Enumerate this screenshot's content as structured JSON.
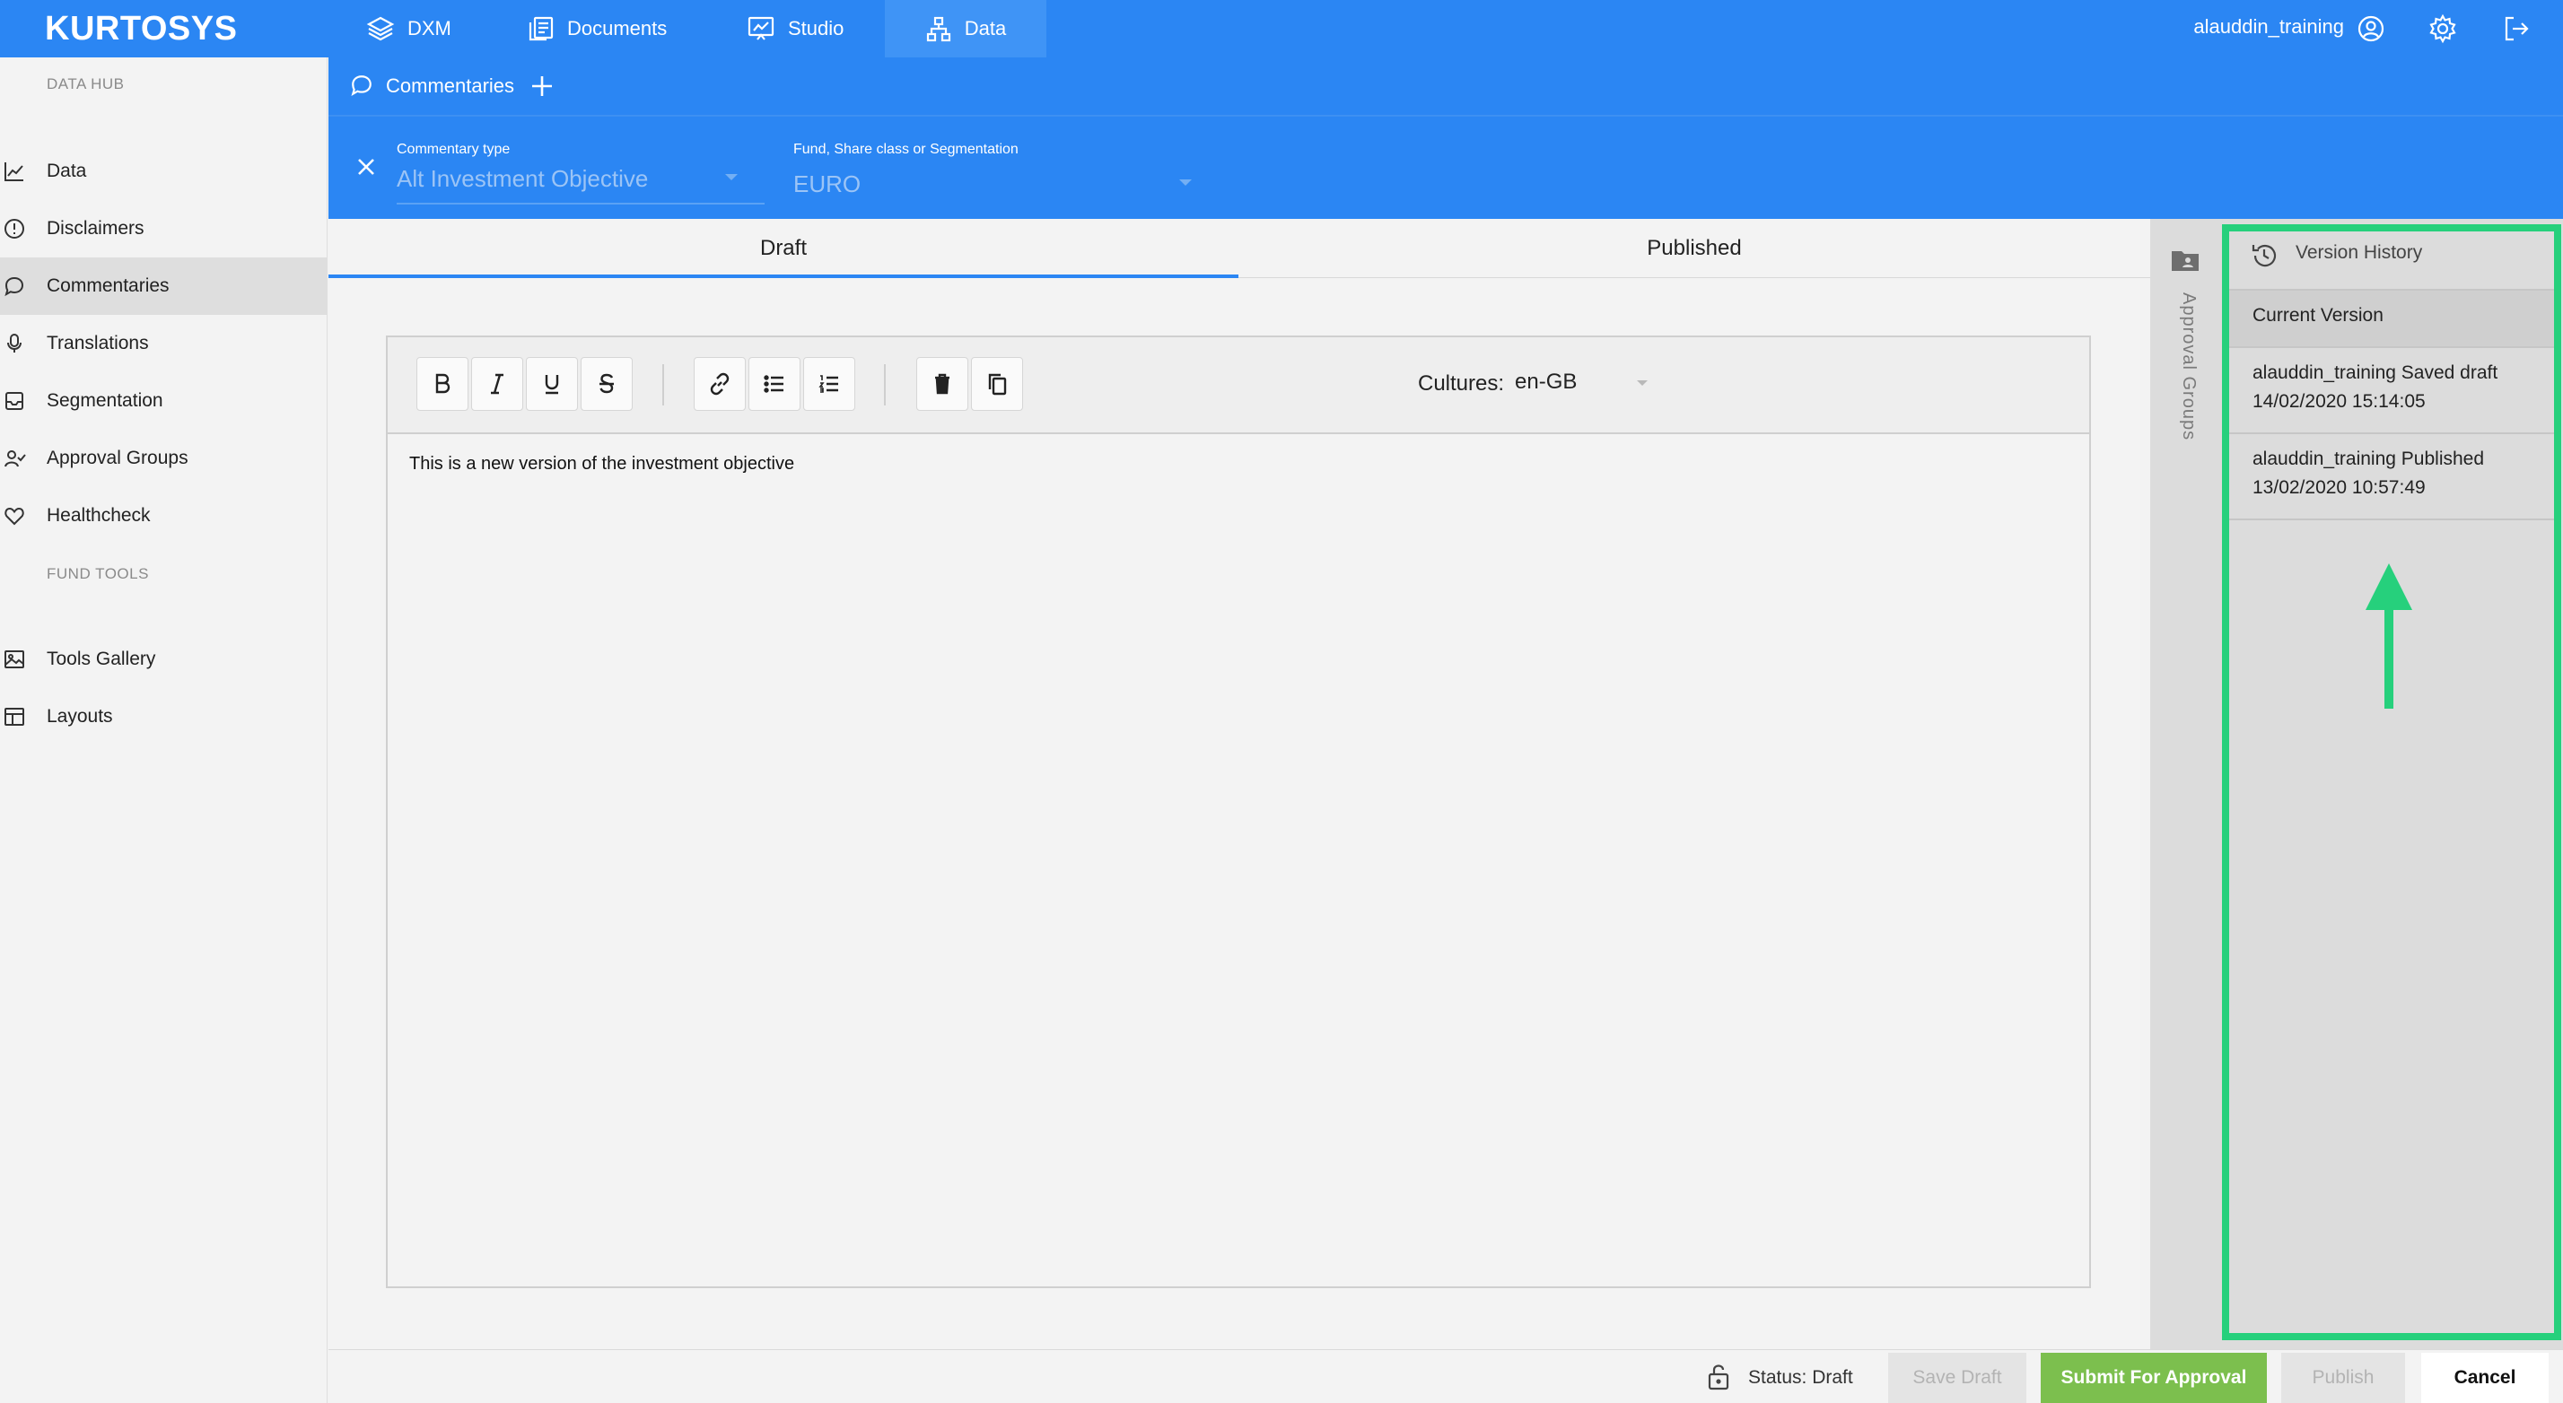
{
  "brand": {
    "logo_text": "KURTOSYS"
  },
  "topnav": {
    "items": [
      {
        "label": "DXM",
        "icon": "layers-icon"
      },
      {
        "label": "Documents",
        "icon": "documents-icon"
      },
      {
        "label": "Studio",
        "icon": "presentation-icon"
      },
      {
        "label": "Data",
        "icon": "hierarchy-icon"
      }
    ],
    "active": "Data",
    "user": "alauddin_training"
  },
  "sidebar": {
    "section_data_hub": "DATA HUB",
    "section_fund_tools": "FUND TOOLS",
    "items": [
      {
        "label": "Data",
        "icon": "line-chart-icon"
      },
      {
        "label": "Disclaimers",
        "icon": "alert-circle-icon"
      },
      {
        "label": "Commentaries",
        "icon": "speech-bubble-icon"
      },
      {
        "label": "Translations",
        "icon": "microphone-icon"
      },
      {
        "label": "Segmentation",
        "icon": "tray-icon"
      },
      {
        "label": "Approval Groups",
        "icon": "user-check-icon"
      },
      {
        "label": "Healthcheck",
        "icon": "heart-icon"
      },
      {
        "label": "Tools Gallery",
        "icon": "image-icon"
      },
      {
        "label": "Layouts",
        "icon": "layout-icon"
      }
    ],
    "active": "Commentaries"
  },
  "subheader": {
    "title": "Commentaries",
    "commentary_type_label": "Commentary type",
    "commentary_type_value": "Alt Investment Objective",
    "fund_label": "Fund, Share class or Segmentation",
    "fund_value": "EURO"
  },
  "tabs": {
    "draft": "Draft",
    "published": "Published",
    "active": "Draft"
  },
  "editor": {
    "cultures_label": "Cultures:",
    "culture_value": "en-GB",
    "content": "This is a new version of the investment objective"
  },
  "approval_groups": {
    "label": "Approval Groups"
  },
  "version_history": {
    "title": "Version History",
    "current": "Current Version",
    "entries": [
      {
        "line1": "alauddin_training Saved draft",
        "line2": "14/02/2020 15:14:05"
      },
      {
        "line1": "alauddin_training Published",
        "line2": "13/02/2020 10:57:49"
      }
    ],
    "highlight_color": "#26d07c"
  },
  "footer": {
    "status": "Status: Draft",
    "save_draft": "Save Draft",
    "submit": "Submit For Approval",
    "publish": "Publish",
    "cancel": "Cancel"
  },
  "colors": {
    "brand_blue": "#2b86f3",
    "submit_green": "#7cbf4e",
    "highlight_green": "#26d07c"
  }
}
